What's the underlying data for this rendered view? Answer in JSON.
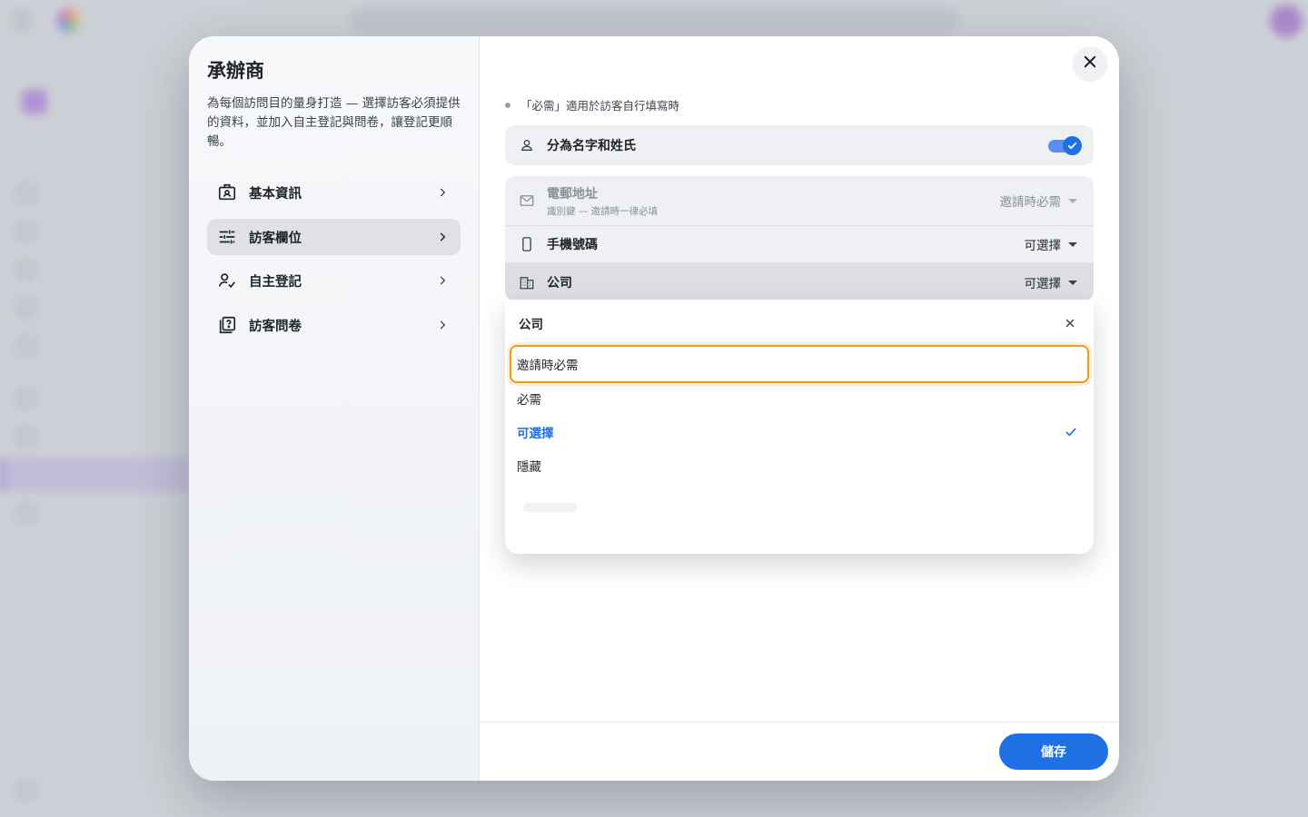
{
  "modal": {
    "title": "承辦商",
    "description": "為每個訪問目的量身打造 — 選擇訪客必須提供的資料，並加入自主登記與問卷，讓登記更順暢。",
    "nav": [
      {
        "label": "基本資訊",
        "icon": "id-badge-icon"
      },
      {
        "label": "訪客欄位",
        "icon": "tune-sliders-icon",
        "active": true
      },
      {
        "label": "自主登記",
        "icon": "person-check-icon"
      },
      {
        "label": "訪客問卷",
        "icon": "questionnaire-icon"
      }
    ],
    "note": "「必需」適用於訪客自行填寫時",
    "name_split": {
      "label": "分為名字和姓氏",
      "enabled": true
    },
    "fields": [
      {
        "label": "電郵地址",
        "sublabel": "識別鍵 — 邀請時一律必填",
        "value": "邀請時必需",
        "icon": "mail-icon",
        "disabled": true
      },
      {
        "label": "手機號碼",
        "value": "可選擇",
        "icon": "phone-icon"
      },
      {
        "label": "公司",
        "value": "可選擇",
        "icon": "building-icon",
        "open": true
      }
    ],
    "dropdown": {
      "title": "公司",
      "options": [
        {
          "label": "邀請時必需",
          "focused": true
        },
        {
          "label": "必需"
        },
        {
          "label": "可選擇",
          "selected": true
        },
        {
          "label": "隱藏"
        }
      ]
    },
    "save_label": "儲存"
  },
  "colors": {
    "accent": "#1f6fe5",
    "focus_ring": "#f29a1a"
  }
}
